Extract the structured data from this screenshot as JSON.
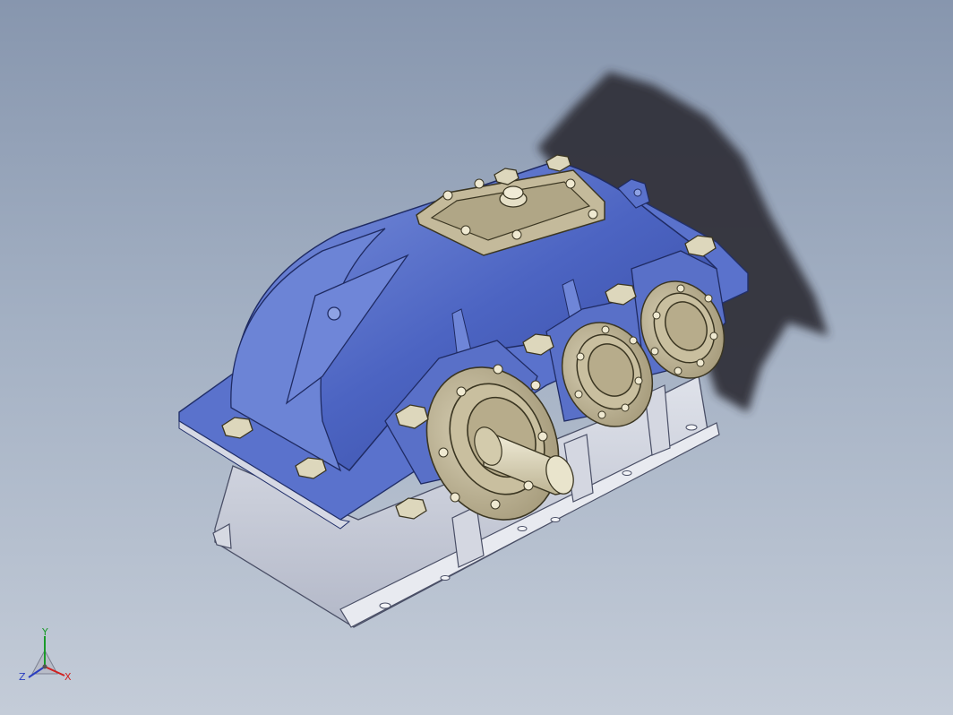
{
  "viewport": {
    "background_top": "#8796ae",
    "background_bottom": "#c4ccd8"
  },
  "model": {
    "colors": {
      "housing": "#4a62bf",
      "housing_light": "#7189d8",
      "housing_dark": "#2e3f8a",
      "base": "#c7cad6",
      "flange": "#b9ad8e",
      "shaft": "#dcd6bb",
      "bolt": "#d8d2b6",
      "shadow": "#30333a"
    }
  },
  "triad": {
    "x_label": "X",
    "y_label": "Y",
    "z_label": "Z",
    "x_color": "#d02020",
    "y_color": "#1a9a2a",
    "z_color": "#2a3ec0"
  }
}
